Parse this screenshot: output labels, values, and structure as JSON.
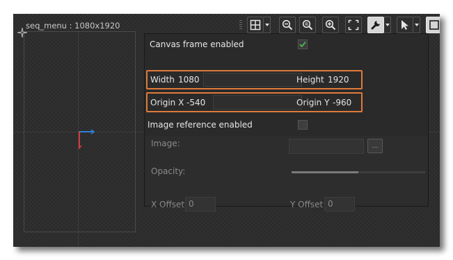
{
  "canvas": {
    "label": "seq_menu : 1080x1920"
  },
  "toolbar": {
    "buttons": [
      {
        "icon": "grid-icon"
      },
      {
        "icon": "zoom-out-icon"
      },
      {
        "icon": "zoom-reset-icon"
      },
      {
        "icon": "zoom-in-icon"
      },
      {
        "icon": "fit-to-screen-icon"
      },
      {
        "icon": "wrench-icon",
        "active": true
      },
      {
        "icon": "pointer-icon"
      },
      {
        "icon": "frame-icon",
        "active": true
      }
    ]
  },
  "panel": {
    "canvas_frame_label": "Canvas frame enabled",
    "canvas_frame_checked": true,
    "width_label": "Width",
    "width_value": "1080",
    "height_label": "Height",
    "height_value": "1920",
    "origin_x_label": "Origin X",
    "origin_x_value": "-540",
    "origin_y_label": "Origin Y",
    "origin_y_value": "-960",
    "image_ref_label": "Image reference enabled",
    "image_ref_checked": false,
    "image_label": "Image:",
    "image_value": "",
    "browse_label": "...",
    "opacity_label": "Opacity:",
    "opacity_value": 0.5,
    "x_offset_label": "X Offset",
    "x_offset_value": "0",
    "y_offset_label": "Y Offset",
    "y_offset_value": "0"
  },
  "colors": {
    "highlight": "#e07a3c",
    "checkmark": "#4caf50",
    "axis_x": "#2f7fd6",
    "axis_y": "#d23b3b"
  }
}
